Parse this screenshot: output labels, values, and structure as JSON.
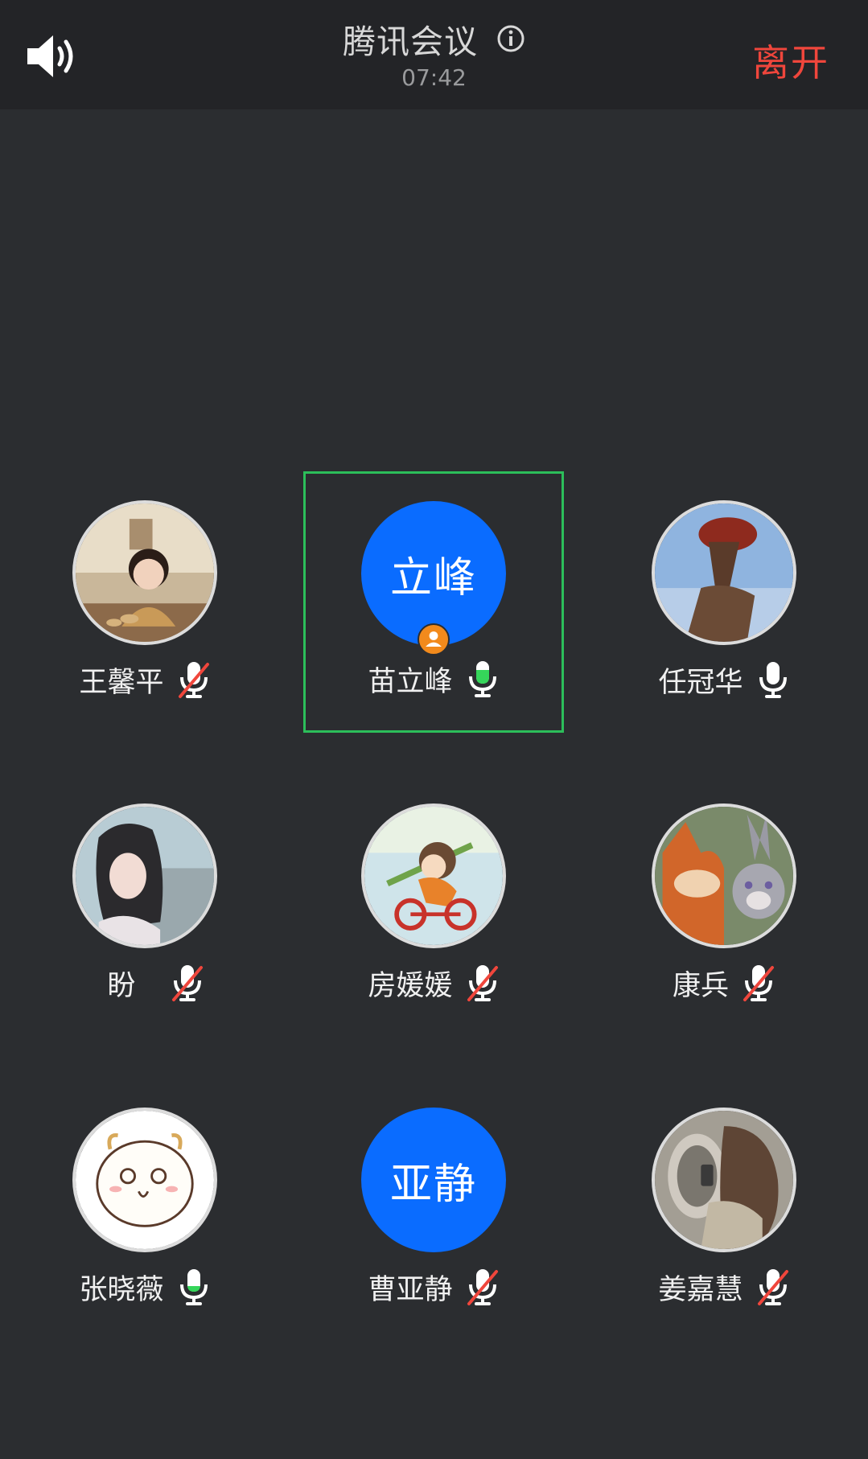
{
  "header": {
    "title": "腾讯会议",
    "duration": "07:42",
    "leave_label": "离开",
    "speaker_icon": "speaker-icon",
    "info_icon": "info-icon"
  },
  "colors": {
    "background": "#2b2d30",
    "header_bg": "#232427",
    "leave": "#f0463c",
    "initials_avatar": "#0a6cff",
    "speaking_border": "#2cbe5a",
    "mic_active": "#35d65a",
    "mic_muted_slash": "#f0463c",
    "host_badge": "#f28a1c"
  },
  "participants": [
    {
      "name": "王馨平",
      "avatar_type": "photo",
      "mic": "muted"
    },
    {
      "name": "苗立峰",
      "avatar_type": "initials",
      "initials": "立峰",
      "mic": "speaking",
      "host": true,
      "active_speaker": true
    },
    {
      "name": "任冠华",
      "avatar_type": "photo",
      "mic": "on"
    },
    {
      "name": "盼",
      "avatar_type": "photo",
      "mic": "muted"
    },
    {
      "name": "房媛媛",
      "avatar_type": "photo",
      "mic": "muted"
    },
    {
      "name": "康兵",
      "avatar_type": "photo",
      "mic": "muted"
    },
    {
      "name": "张晓薇",
      "avatar_type": "photo",
      "mic": "level-low"
    },
    {
      "name": "曹亚静",
      "avatar_type": "initials",
      "initials": "亚静",
      "mic": "muted"
    },
    {
      "name": "姜嘉慧",
      "avatar_type": "photo",
      "mic": "muted"
    }
  ]
}
